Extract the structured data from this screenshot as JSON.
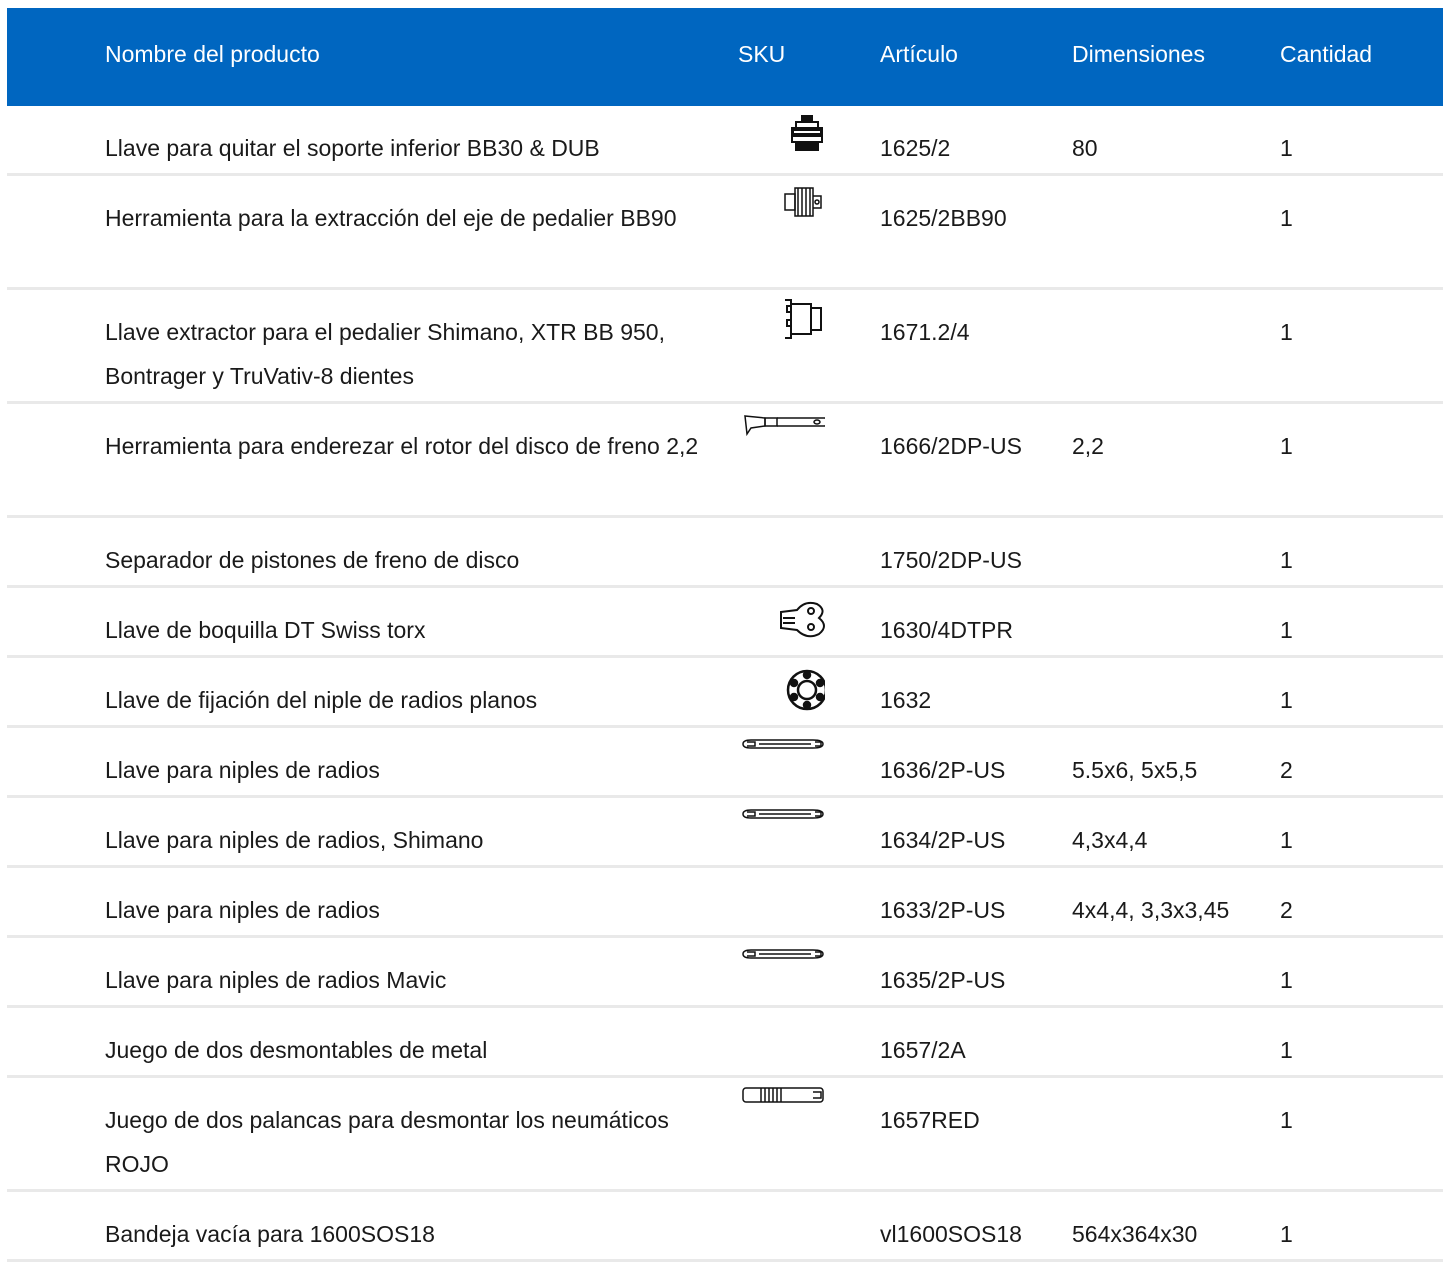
{
  "header": {
    "name": "Nombre del producto",
    "sku": "SKU",
    "article": "Artículo",
    "dimensions": "Dimensiones",
    "quantity": "Cantidad"
  },
  "rows": [
    {
      "name": "Llave para quitar el soporte inferior BB30 & DUB",
      "icon": "bottom-bracket-tool-icon",
      "article": "1625/2",
      "dimensions": "80",
      "quantity": "1"
    },
    {
      "name": "Herramienta para la extracción del eje de pedalier BB90",
      "icon": "bb90-extractor-icon",
      "article": "1625/2BB90",
      "dimensions": "",
      "quantity": "1"
    },
    {
      "name": "Llave extractor para el pedalier Shimano, XTR BB 950, Bontrager y TruVativ-8 dientes",
      "icon": "splined-extractor-icon",
      "article": "1671.2/4",
      "dimensions": "",
      "quantity": "1"
    },
    {
      "name": "Herramienta para enderezar el rotor del disco de freno 2,2",
      "icon": "rotor-straightener-icon",
      "article": "1666/2DP-US",
      "dimensions": "2,2",
      "quantity": "1"
    },
    {
      "name": "Separador de pistones de freno de disco",
      "icon": "",
      "article": "1750/2DP-US",
      "dimensions": "",
      "quantity": "1"
    },
    {
      "name": "Llave de boquilla DT Swiss torx",
      "icon": "torx-nipple-wrench-icon",
      "article": "1630/4DTPR",
      "dimensions": "",
      "quantity": "1"
    },
    {
      "name": "Llave de fijación del niple de radios planos",
      "icon": "spoke-holder-icon",
      "article": "1632",
      "dimensions": "",
      "quantity": "1"
    },
    {
      "name": "Llave para niples de radios",
      "icon": "spoke-wrench-icon",
      "article": "1636/2P-US",
      "dimensions": "5.5x6, 5x5,5",
      "quantity": "2"
    },
    {
      "name": "Llave para niples de radios, Shimano",
      "icon": "spoke-wrench-icon",
      "article": "1634/2P-US",
      "dimensions": "4,3x4,4",
      "quantity": "1"
    },
    {
      "name": "Llave para niples de radios",
      "icon": "",
      "article": "1633/2P-US",
      "dimensions": "4x4,4, 3,3x3,45",
      "quantity": "2"
    },
    {
      "name": "Llave para niples de radios Mavic",
      "icon": "spoke-wrench-icon",
      "article": "1635/2P-US",
      "dimensions": "",
      "quantity": "1"
    },
    {
      "name": "Juego de dos desmontables de metal",
      "icon": "",
      "article": "1657/2A",
      "dimensions": "",
      "quantity": "1"
    },
    {
      "name": "Juego de dos palancas para desmontar los neumáticos ROJO",
      "icon": "tire-lever-icon",
      "article": "1657RED",
      "dimensions": "",
      "quantity": "1"
    },
    {
      "name": "Bandeja vacía para 1600SOS18",
      "icon": "",
      "article": "vl1600SOS18",
      "dimensions": "564x364x30",
      "quantity": "1"
    }
  ]
}
